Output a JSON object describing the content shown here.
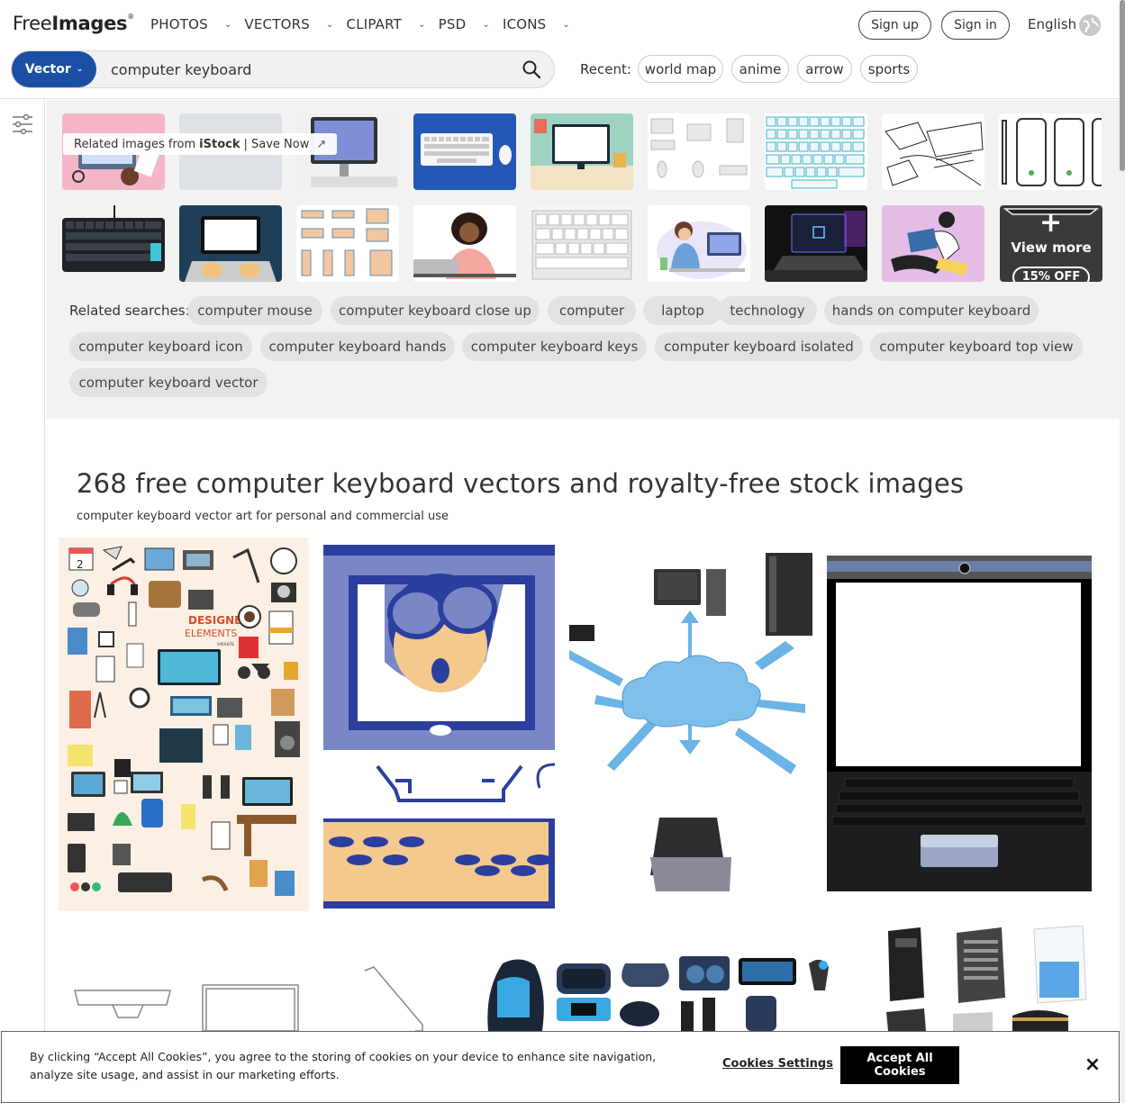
{
  "header": {
    "logo_prefix": "Free",
    "logo_bold": "Images",
    "logo_reg": "®",
    "nav": [
      {
        "label": "PHOTOS"
      },
      {
        "label": "VECTORS"
      },
      {
        "label": "CLIPART"
      },
      {
        "label": "PSD"
      },
      {
        "label": "ICONS"
      }
    ],
    "sign_up": "Sign up",
    "sign_in": "Sign in",
    "language": "English"
  },
  "search": {
    "type_label": "Vector",
    "query": "computer keyboard",
    "recent_label": "Recent:",
    "recent": [
      "world map",
      "anime",
      "arrow",
      "sports"
    ]
  },
  "related": {
    "istock_prefix": "Related images from",
    "istock_brand": "iStock",
    "istock_cta": "| Save Now",
    "view_more": "View more",
    "discount": "15% OFF",
    "searches_label": "Related searches:",
    "searches": [
      "computer mouse",
      "computer keyboard close up",
      "computer",
      "laptop",
      "technology",
      "hands on computer keyboard",
      "computer keyboard icon",
      "computer keyboard hands",
      "computer keyboard keys",
      "computer keyboard isolated",
      "computer keyboard top view",
      "computer keyboard vector"
    ]
  },
  "results": {
    "title": "268 free computer keyboard vectors and royalty-free stock images",
    "subtitle": "computer keyboard vector art for personal and commercial use",
    "designer_title": "DESIGNER",
    "designer_sub": "ELEMENTS",
    "designer_brand": "vexels",
    "calendar_day": "2"
  },
  "cookie": {
    "text": "By clicking “Accept All Cookies”, you agree to the storing of cookies on your device to enhance site navigation, analyze site usage, and assist in our marketing efforts.",
    "settings": "Cookies Settings",
    "accept": "Accept All Cookies",
    "close": "×"
  },
  "colors": {
    "brand_blue": "#1b4fa3",
    "section_gray": "#f2f2f2",
    "chip_gray": "#e2e2e2"
  }
}
